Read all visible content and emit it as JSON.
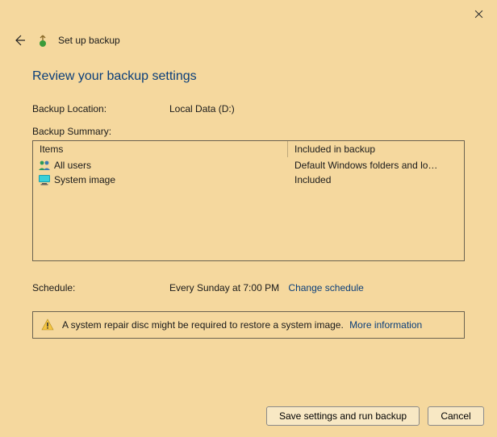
{
  "window": {
    "title": "Set up backup"
  },
  "page": {
    "heading": "Review your backup settings",
    "backup_location_label": "Backup Location:",
    "backup_location_value": "Local Data (D:)",
    "backup_summary_label": "Backup Summary:"
  },
  "table": {
    "col_items": "Items",
    "col_included": "Included in backup",
    "rows": [
      {
        "icon": "users-icon",
        "name": "All users",
        "included": "Default Windows folders and lo…"
      },
      {
        "icon": "monitor-icon",
        "name": "System image",
        "included": "Included"
      }
    ]
  },
  "schedule": {
    "label": "Schedule:",
    "value": "Every Sunday at 7:00 PM",
    "change_link": "Change schedule"
  },
  "info": {
    "text": "A system repair disc might be required to restore a system image.",
    "link": "More information"
  },
  "buttons": {
    "primary": "Save settings and run backup",
    "cancel": "Cancel"
  }
}
